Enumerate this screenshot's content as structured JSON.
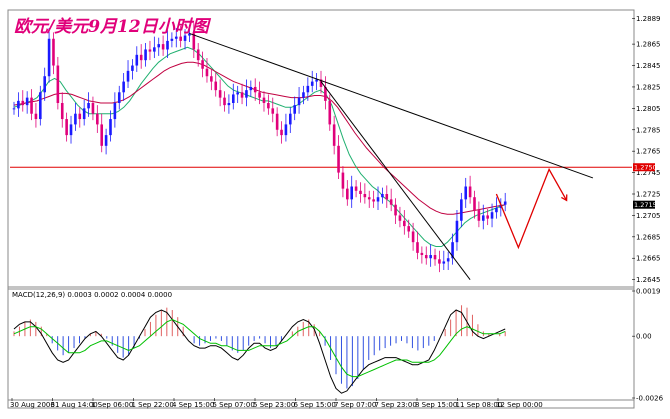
{
  "chart_data": [
    {
      "type": "candlestick",
      "title": "欧元/美元9月12日小时图",
      "ylim": [
        1.264,
        1.2895
      ],
      "y_ticks": [
        "1.2889",
        "1.2865",
        "1.2845",
        "1.2825",
        "1.2805",
        "1.2785",
        "1.2765",
        "1.2745",
        "1.2725",
        "1.2705",
        "1.2685",
        "1.2665",
        "1.2645"
      ],
      "x_ticks": [
        "30 Aug 2006",
        "31 Aug 14:00",
        "1 Sep 06:00",
        "1 Sep 22:00",
        "4 Sep 15:00",
        "5 Sep 07:00",
        "5 Sep 23:00",
        "6 Sep 15:00",
        "7 Sep 07:00",
        "7 Sep 23:00",
        "8 Sep 15:00",
        "11 Sep 08:00",
        "12 Sep 00:00"
      ],
      "price_tags": {
        "resistance": "1.2750",
        "current": "1.2715"
      },
      "levels": {
        "horizontal_line": 1.275
      },
      "trendlines": [
        {
          "from": {
            "bar": 40,
            "price": 1.2875
          },
          "to": {
            "bar": 132,
            "price": 1.274
          }
        },
        {
          "from": {
            "bar": 70,
            "price": 1.283
          },
          "to": {
            "bar": 104,
            "price": 1.2645
          }
        }
      ],
      "projection": [
        {
          "bar": 110,
          "price": 1.2725
        },
        {
          "bar": 115,
          "price": 1.2675
        },
        {
          "bar": 122,
          "price": 1.2748
        },
        {
          "bar": 126,
          "price": 1.2719
        }
      ],
      "series_price": [
        1.2805,
        1.2812,
        1.2808,
        1.2815,
        1.28,
        1.2795,
        1.282,
        1.2835,
        1.287,
        1.2845,
        1.281,
        1.2795,
        1.278,
        1.279,
        1.28,
        1.2795,
        1.2805,
        1.281,
        1.28,
        1.279,
        1.277,
        1.278,
        1.2795,
        1.281,
        1.282,
        1.283,
        1.284,
        1.2845,
        1.2855,
        1.285,
        1.286,
        1.2858,
        1.2862,
        1.2865,
        1.286,
        1.2868,
        1.287,
        1.2872,
        1.2868,
        1.2873,
        1.2875,
        1.286,
        1.285,
        1.2842,
        1.2835,
        1.283,
        1.2822,
        1.2815,
        1.2808,
        1.281,
        1.2818,
        1.282,
        1.2815,
        1.2822,
        1.2825,
        1.282,
        1.2815,
        1.281,
        1.2805,
        1.28,
        1.2785,
        1.278,
        1.279,
        1.28,
        1.2808,
        1.2815,
        1.282,
        1.2826,
        1.283,
        1.2832,
        1.2825,
        1.2812,
        1.279,
        1.277,
        1.2745,
        1.273,
        1.272,
        1.2732,
        1.2728,
        1.2725,
        1.2722,
        1.272,
        1.2718,
        1.2722,
        1.2725,
        1.272,
        1.2715,
        1.2705,
        1.27,
        1.2695,
        1.269,
        1.268,
        1.267,
        1.2668,
        1.2665,
        1.2668,
        1.2664,
        1.266,
        1.2662,
        1.2665,
        1.268,
        1.27,
        1.272,
        1.2732,
        1.2722,
        1.271,
        1.27,
        1.2705,
        1.2702,
        1.2708,
        1.2712,
        1.2715,
        1.2718
      ],
      "ma_fast": [
        1.2806,
        1.2808,
        1.281,
        1.2812,
        1.2815,
        1.2822,
        1.283,
        1.2833,
        1.283,
        1.2822,
        1.2815,
        1.2808,
        1.2803,
        1.28,
        1.28,
        1.28,
        1.28,
        1.28,
        1.2802,
        1.2806,
        1.2812,
        1.282,
        1.2828,
        1.2835,
        1.2842,
        1.2848,
        1.2852,
        1.2856,
        1.2858,
        1.286,
        1.2862,
        1.286,
        1.2856,
        1.285,
        1.2844,
        1.2838,
        1.2832,
        1.2826,
        1.2822,
        1.282,
        1.2818,
        1.2816,
        1.2814,
        1.2812,
        1.2812,
        1.281,
        1.2808,
        1.2806,
        1.2806,
        1.2808,
        1.2812,
        1.2816,
        1.282,
        1.2822,
        1.2818,
        1.2808,
        1.2792,
        1.2776,
        1.2762,
        1.2752,
        1.2744,
        1.2738,
        1.2732,
        1.2728,
        1.2722,
        1.2718,
        1.2712,
        1.2706,
        1.27,
        1.2694,
        1.2688,
        1.2682,
        1.2678,
        1.2676,
        1.2676,
        1.268,
        1.2686,
        1.2692,
        1.2698,
        1.2702,
        1.2705,
        1.2707,
        1.2709,
        1.2711,
        1.2713,
        1.2715
      ],
      "ma_slow": [
        1.2808,
        1.2809,
        1.281,
        1.2811,
        1.2812,
        1.2814,
        1.2816,
        1.2818,
        1.2819,
        1.2819,
        1.2818,
        1.2816,
        1.2814,
        1.2812,
        1.2811,
        1.281,
        1.281,
        1.281,
        1.2811,
        1.2813,
        1.2816,
        1.282,
        1.2824,
        1.2828,
        1.2832,
        1.2836,
        1.284,
        1.2843,
        1.2845,
        1.2847,
        1.2848,
        1.2848,
        1.2847,
        1.2845,
        1.2842,
        1.2839,
        1.2836,
        1.2833,
        1.283,
        1.2828,
        1.2826,
        1.2824,
        1.2822,
        1.282,
        1.2819,
        1.2818,
        1.2817,
        1.2816,
        1.2815,
        1.2815,
        1.2815,
        1.2816,
        1.2817,
        1.2817,
        1.2816,
        1.2812,
        1.2806,
        1.2798,
        1.279,
        1.2782,
        1.2775,
        1.2768,
        1.2762,
        1.2756,
        1.275,
        1.2745,
        1.274,
        1.2735,
        1.273,
        1.2725,
        1.272,
        1.2716,
        1.2712,
        1.2709,
        1.2707,
        1.2706,
        1.2706,
        1.2707,
        1.2708,
        1.2709,
        1.271,
        1.2711,
        1.2712,
        1.2713,
        1.2714,
        1.2715
      ]
    },
    {
      "type": "bar",
      "title": "MACD(12,26,9) 0.0003 0.0002 0.0004 0.0000",
      "ylim": [
        -0.0026,
        0.0019
      ],
      "y_ticks": [
        "0.0019",
        "0.00",
        "-0.0026"
      ],
      "histogram": [
        0.0002,
        0.0004,
        0.0006,
        0.0007,
        0.0006,
        0.0004,
        0.0001,
        -0.0003,
        -0.0006,
        -0.0008,
        -0.0007,
        -0.0005,
        -0.0003,
        -0.0001,
        0.0001,
        0.0002,
        0.0001,
        -0.0001,
        -0.0004,
        -0.0007,
        -0.0009,
        -0.0008,
        -0.0005,
        -0.0001,
        0.0003,
        0.0006,
        0.0009,
        0.0011,
        0.0012,
        0.0011,
        0.0008,
        0.0004,
        0.0,
        -0.0003,
        -0.0004,
        -0.0003,
        -0.0002,
        -0.0001,
        -0.0002,
        -0.0004,
        -0.0006,
        -0.0007,
        -0.0006,
        -0.0004,
        -0.0002,
        -0.0001,
        -0.0003,
        -0.0005,
        -0.0004,
        -0.0002,
        0.0,
        0.0002,
        0.0004,
        0.0006,
        0.0007,
        0.0005,
        0.0002,
        -0.0004,
        -0.001,
        -0.0016,
        -0.002,
        -0.0022,
        -0.0021,
        -0.0018,
        -0.0014,
        -0.001,
        -0.0008,
        -0.0006,
        -0.0005,
        -0.0004,
        -0.0003,
        -0.0002,
        -0.0003,
        -0.0005,
        -0.0006,
        -0.0005,
        -0.0004,
        -0.0002,
        0.0,
        0.0003,
        0.0007,
        0.0011,
        0.0013,
        0.0012,
        0.0009,
        0.0005,
        0.0002,
        0.0001,
        0.0,
        0.0001,
        0.0002
      ],
      "macd_line": [
        0.0003,
        0.0005,
        0.0006,
        0.0006,
        0.0004,
        0.0001,
        -0.0003,
        -0.0007,
        -0.001,
        -0.0011,
        -0.001,
        -0.0007,
        -0.0004,
        -0.0001,
        0.0001,
        0.0002,
        0.0,
        -0.0003,
        -0.0006,
        -0.0009,
        -0.001,
        -0.0008,
        -0.0004,
        0.0,
        0.0004,
        0.0008,
        0.001,
        0.0011,
        0.001,
        0.0007,
        0.0004,
        0.0001,
        -0.0002,
        -0.0004,
        -0.0005,
        -0.0005,
        -0.0004,
        -0.0004,
        -0.0005,
        -0.0007,
        -0.0009,
        -0.001,
        -0.0008,
        -0.0005,
        -0.0003,
        -0.0003,
        -0.0005,
        -0.0006,
        -0.0005,
        -0.0002,
        0.0001,
        0.0004,
        0.0006,
        0.0007,
        0.0006,
        0.0003,
        -0.0003,
        -0.001,
        -0.0017,
        -0.0022,
        -0.0024,
        -0.0023,
        -0.002,
        -0.0017,
        -0.0014,
        -0.0012,
        -0.0011,
        -0.001,
        -0.0009,
        -0.0009,
        -0.0009,
        -0.001,
        -0.0011,
        -0.0012,
        -0.0012,
        -0.0011,
        -0.001,
        -0.0006,
        -0.0001,
        0.0004,
        0.0009,
        0.0011,
        0.001,
        0.0006,
        0.0002,
        0.0,
        -0.0001,
        0.0,
        0.0001,
        0.0002,
        0.0003
      ],
      "signal_line": [
        0.0001,
        0.0002,
        0.0003,
        0.0004,
        0.0004,
        0.0003,
        0.0001,
        -0.0001,
        -0.0003,
        -0.0005,
        -0.0007,
        -0.0007,
        -0.0007,
        -0.0006,
        -0.0004,
        -0.0003,
        -0.0002,
        -0.0002,
        -0.0003,
        -0.0004,
        -0.0005,
        -0.0006,
        -0.0005,
        -0.0004,
        -0.0002,
        0.0,
        0.0002,
        0.0004,
        0.0006,
        0.0007,
        0.0006,
        0.0005,
        0.0003,
        0.0001,
        -0.0001,
        -0.0002,
        -0.0003,
        -0.0003,
        -0.0004,
        -0.0004,
        -0.0005,
        -0.0006,
        -0.0006,
        -0.0006,
        -0.0005,
        -0.0004,
        -0.0004,
        -0.0004,
        -0.0004,
        -0.0003,
        -0.0002,
        0.0,
        0.0002,
        0.0003,
        0.0004,
        0.0004,
        0.0002,
        -0.0001,
        -0.0005,
        -0.0009,
        -0.0013,
        -0.0016,
        -0.0017,
        -0.0017,
        -0.0016,
        -0.0015,
        -0.0014,
        -0.0013,
        -0.0012,
        -0.0011,
        -0.001,
        -0.001,
        -0.001,
        -0.0011,
        -0.0011,
        -0.0011,
        -0.0011,
        -0.001,
        -0.0008,
        -0.0005,
        -0.0002,
        0.0001,
        0.0003,
        0.0004,
        0.0003,
        0.0002,
        0.0001,
        0.0001,
        0.0001,
        0.0001,
        0.0002
      ]
    }
  ],
  "colors": {
    "bull": "#1a1aff",
    "bear": "#e0007a",
    "ma_fast": "#20b070",
    "ma_slow": "#c00040",
    "trend": "#000000",
    "resistance": "#e00000",
    "projection": "#e00000",
    "hist_pos": "#e06060",
    "hist_neg": "#3050e0",
    "macd": "#000000",
    "signal": "#00c000"
  }
}
